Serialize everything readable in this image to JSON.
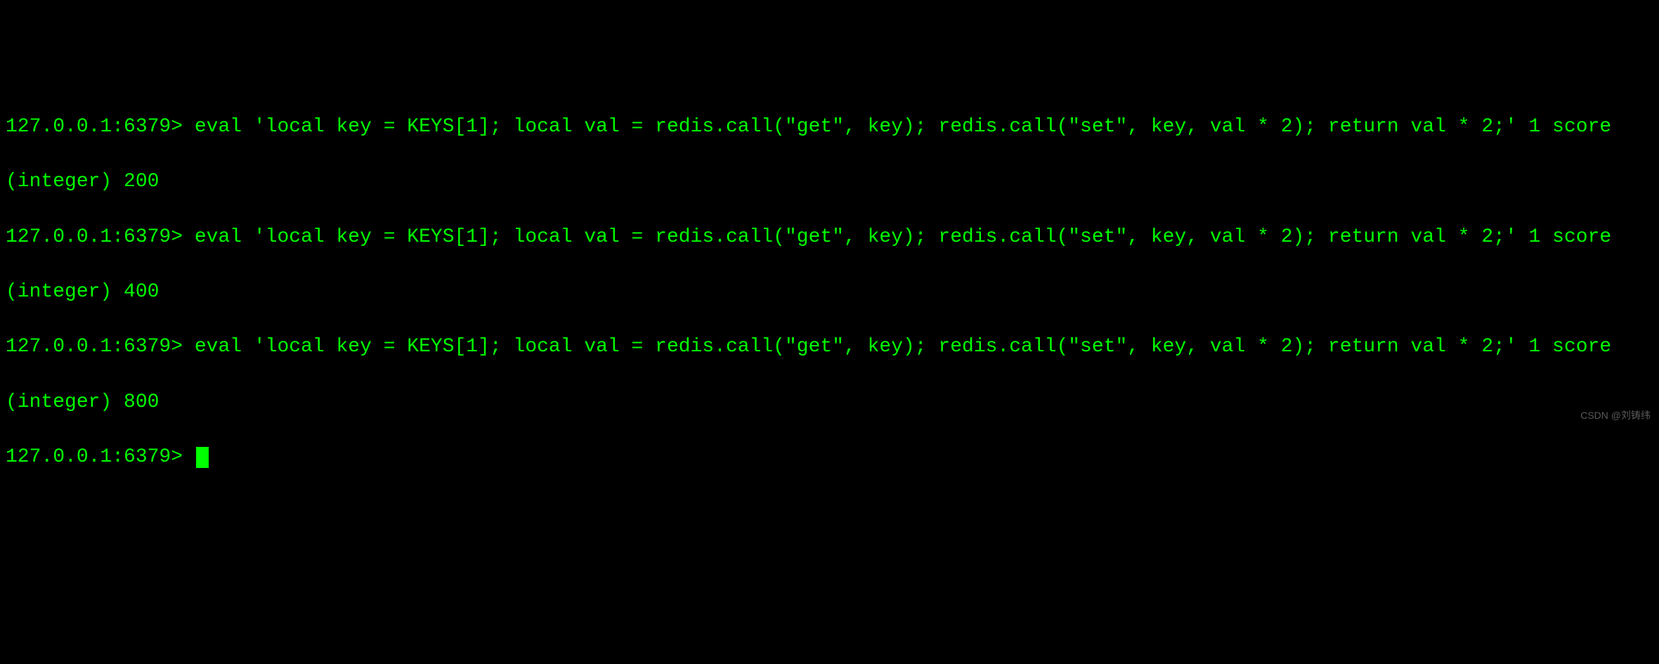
{
  "terminal": {
    "prompt1": "127.0.0.1:6379> ",
    "command1": "eval 'local key = KEYS[1]; local val = redis.call(\"get\", key); redis.call(\"set\", key, val * 2); return val * 2;' 1 score",
    "output1": "(integer) 200",
    "prompt2": "127.0.0.1:6379> ",
    "command2": "eval 'local key = KEYS[1]; local val = redis.call(\"get\", key); redis.call(\"set\", key, val * 2); return val * 2;' 1 score",
    "output2": "(integer) 400",
    "prompt3": "127.0.0.1:6379> ",
    "command3": "eval 'local key = KEYS[1]; local val = redis.call(\"get\", key); redis.call(\"set\", key, val * 2); return val * 2;' 1 score",
    "output3": "(integer) 800",
    "prompt4": "127.0.0.1:6379> "
  },
  "watermark": "CSDN @刘铸纬"
}
